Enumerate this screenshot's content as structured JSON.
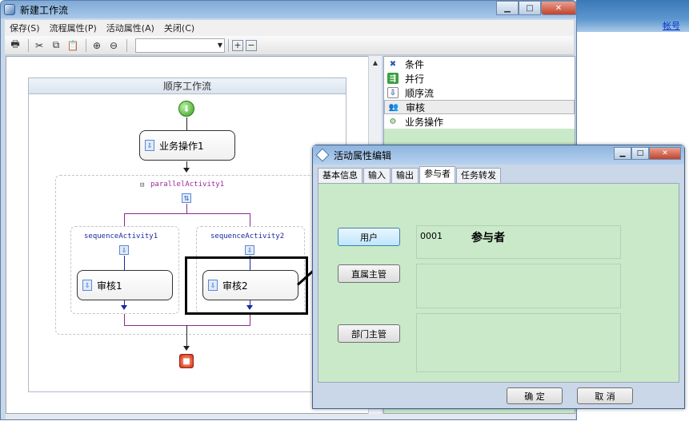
{
  "window": {
    "title": "新建工作流",
    "min": "0",
    "max": "1",
    "close": "r"
  },
  "background": {
    "link": "帐号"
  },
  "menu": [
    "保存(S)",
    "流程属性(P)",
    "活动属性(A)",
    "关闭(C)"
  ],
  "toolbar": {
    "icons": [
      "print-icon",
      "cut-icon",
      "copy-icon",
      "paste-icon",
      "zoom-in-icon",
      "zoom-out-icon"
    ],
    "combo_value": "",
    "expand": "+",
    "collapse": "−"
  },
  "designer": {
    "root_title": "顺序工作流",
    "activity1": "业务操作1",
    "parallel": "parallelActivity1",
    "seq1": "sequenceActivity1",
    "seq2": "sequenceActivity2",
    "review1": "审核1",
    "review2": "审核2"
  },
  "toolbox": [
    {
      "label": "条件",
      "icon": "condition-icon"
    },
    {
      "label": "并行",
      "icon": "parallel-icon"
    },
    {
      "label": "顺序流",
      "icon": "sequence-icon"
    },
    {
      "label": "审核",
      "icon": "review-icon"
    },
    {
      "label": "业务操作",
      "icon": "business-icon"
    }
  ],
  "dialog": {
    "title": "活动属性编辑",
    "tabs": [
      "基本信息",
      "输入",
      "输出",
      "参与者",
      "任务转发"
    ],
    "active_tab": "参与者",
    "participants": [
      {
        "button": "用户",
        "code": "0001",
        "name": "参与者"
      },
      {
        "button": "直属主管",
        "code": "",
        "name": ""
      },
      {
        "button": "部门主管",
        "code": "",
        "name": ""
      }
    ],
    "ok": "确 定",
    "cancel": "取 消"
  },
  "colors": {
    "pane_green": "#c9e9c9",
    "chrome_blue": "#c9d7e8",
    "parallel_line": "#8a2a8a"
  }
}
